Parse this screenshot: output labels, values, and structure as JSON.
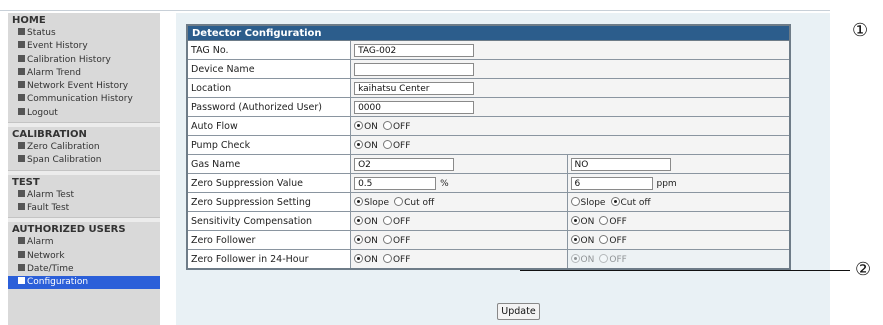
{
  "sidebar": {
    "home": {
      "title": "HOME",
      "items": [
        "Status",
        "Event History",
        "Calibration History",
        "Alarm Trend",
        "Network Event History",
        "Communication History",
        "Logout"
      ]
    },
    "calibration": {
      "title": "CALIBRATION",
      "items": [
        "Zero Calibration",
        "Span Calibration"
      ]
    },
    "test": {
      "title": "TEST",
      "items": [
        "Alarm Test",
        "Fault Test"
      ]
    },
    "authorized": {
      "title": "AUTHORIZED USERS",
      "items": [
        "Alarm",
        "Network",
        "Date/Time",
        "Configuration"
      ]
    }
  },
  "config": {
    "header": "Detector Configuration",
    "rows": {
      "tag_no": {
        "label": "TAG No.",
        "value": "TAG-002"
      },
      "device_name": {
        "label": "Device Name",
        "value": ""
      },
      "location": {
        "label": "Location",
        "value": "kaihatsu Center"
      },
      "password": {
        "label": "Password (Authorized User)",
        "value": "0000"
      },
      "auto_flow": {
        "label": "Auto Flow",
        "opt_on": "ON",
        "opt_off": "OFF"
      },
      "pump_check": {
        "label": "Pump Check",
        "opt_on": "ON",
        "opt_off": "OFF"
      },
      "gas_name": {
        "label": "Gas Name",
        "value1": "O2",
        "value2": "NO"
      },
      "zero_supp_value": {
        "label": "Zero Suppression Value",
        "value1": "0.5",
        "unit1": "%",
        "value2": "6",
        "unit2": "ppm"
      },
      "zero_supp_setting": {
        "label": "Zero Suppression Setting",
        "opt_slope": "Slope",
        "opt_cutoff": "Cut off"
      },
      "sensitivity": {
        "label": "Sensitivity Compensation",
        "opt_on": "ON",
        "opt_off": "OFF"
      },
      "zero_follower": {
        "label": "Zero Follower",
        "opt_on": "ON",
        "opt_off": "OFF"
      },
      "zero_follower_24": {
        "label": "Zero Follower in 24-Hour",
        "opt_on": "ON",
        "opt_off": "OFF"
      }
    },
    "update_label": "Update"
  },
  "callouts": {
    "one": "①",
    "two": "②"
  }
}
